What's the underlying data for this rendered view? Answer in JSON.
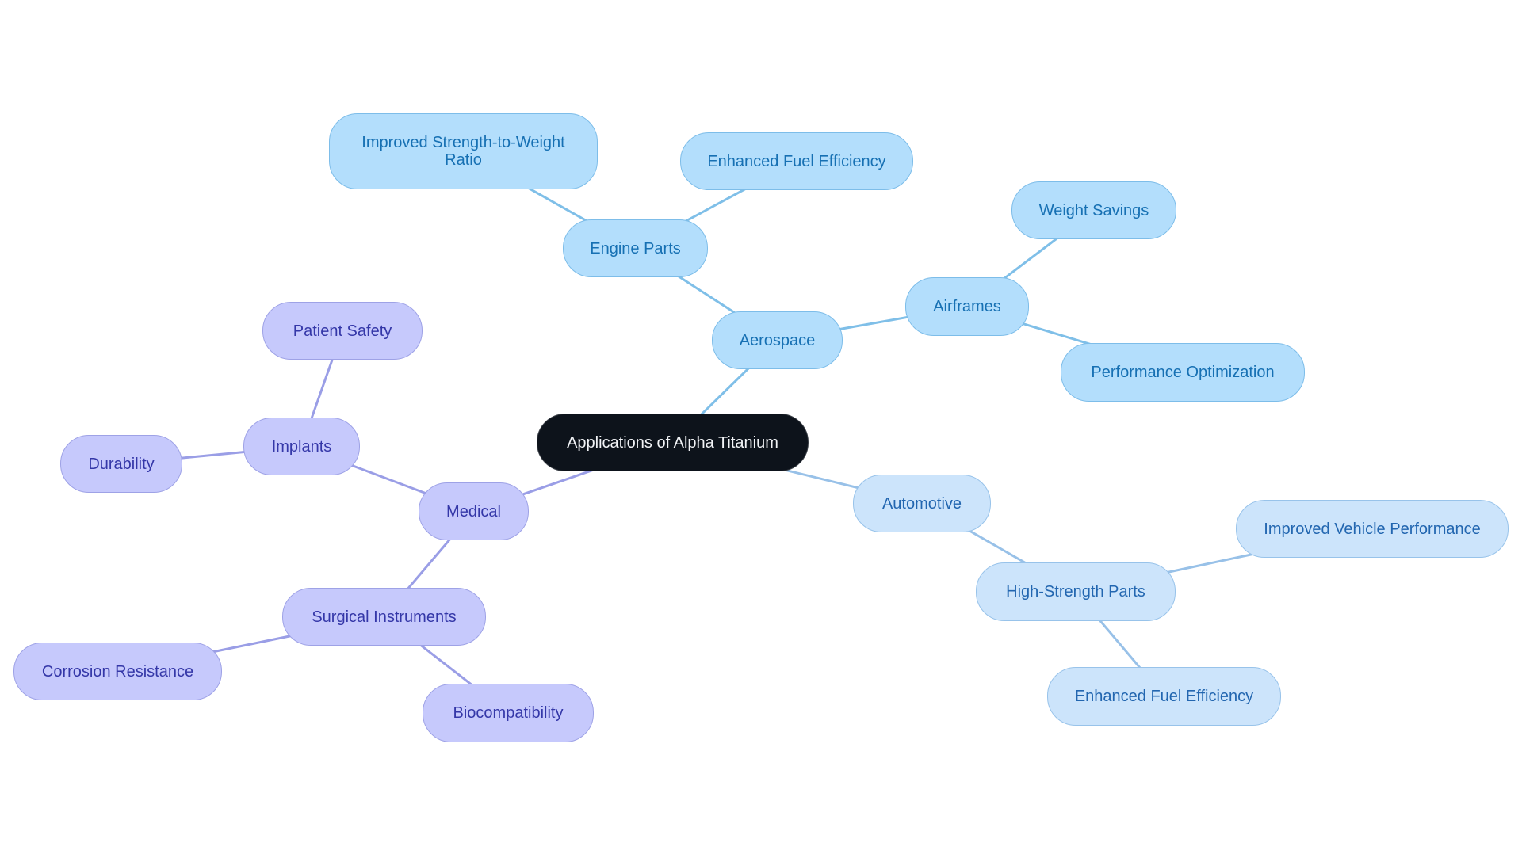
{
  "title": "Applications of Alpha Titanium",
  "colors": {
    "root_fill": "#0d131b",
    "root_text": "#f2f4f7",
    "aerospace_fill": "#b3defc",
    "aerospace_stroke": "#7dbde9",
    "aerospace_text": "#1670b3",
    "aerospace_edge": "#7fbfe8",
    "automotive_fill": "#cce4fb",
    "automotive_stroke": "#98c3ea",
    "automotive_text": "#2266b0",
    "automotive_edge": "#98c1e8",
    "medical_fill": "#c6c9fc",
    "medical_stroke": "#9ea2e6",
    "medical_text": "#3437a8",
    "medical_edge": "#9a9ee6"
  },
  "root": {
    "label": "Applications of Alpha Titanium"
  },
  "branches": [
    {
      "id": "aerospace",
      "label": "Aerospace",
      "children": [
        {
          "id": "engine-parts",
          "label": "Engine Parts",
          "children": [
            {
              "id": "improved-strength-to-weight-ratio",
              "label": "Improved Strength-to-Weight Ratio"
            },
            {
              "id": "enhanced-fuel-efficiency-aero",
              "label": "Enhanced Fuel Efficiency"
            }
          ]
        },
        {
          "id": "airframes",
          "label": "Airframes",
          "children": [
            {
              "id": "weight-savings",
              "label": "Weight Savings"
            },
            {
              "id": "performance-optimization",
              "label": "Performance Optimization"
            }
          ]
        }
      ]
    },
    {
      "id": "automotive",
      "label": "Automotive",
      "children": [
        {
          "id": "high-strength-parts",
          "label": "High-Strength Parts",
          "children": [
            {
              "id": "improved-vehicle-performance",
              "label": "Improved Vehicle Performance"
            },
            {
              "id": "enhanced-fuel-efficiency-auto",
              "label": "Enhanced Fuel Efficiency"
            }
          ]
        }
      ]
    },
    {
      "id": "medical",
      "label": "Medical",
      "children": [
        {
          "id": "implants",
          "label": "Implants",
          "children": [
            {
              "id": "patient-safety",
              "label": "Patient Safety"
            },
            {
              "id": "durability",
              "label": "Durability"
            }
          ]
        },
        {
          "id": "surgical-instruments",
          "label": "Surgical Instruments",
          "children": [
            {
              "id": "corrosion-resistance",
              "label": "Corrosion Resistance"
            },
            {
              "id": "biocompatibility",
              "label": "Biocompatibility"
            }
          ]
        }
      ]
    }
  ]
}
